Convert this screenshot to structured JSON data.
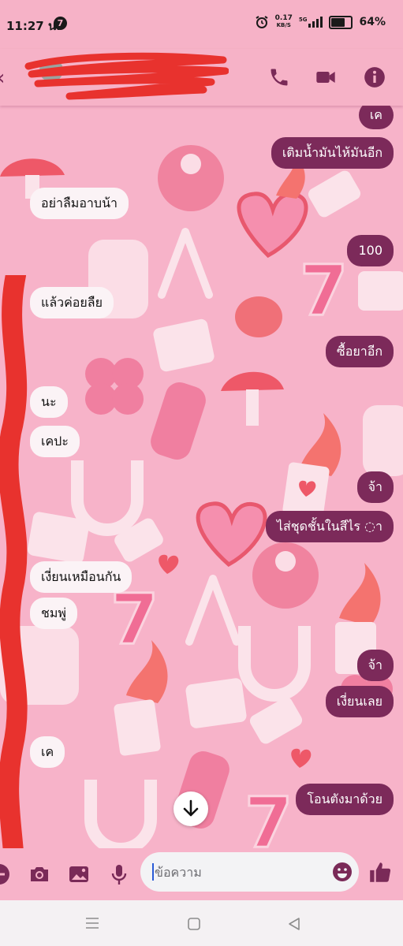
{
  "status_bar": {
    "time": "11:27 น.",
    "notification_count": "7",
    "net_speed_value": "0.17",
    "net_speed_unit": "KB/S",
    "network_type": "5G",
    "battery_level": 0.64,
    "battery_percent": "64%"
  },
  "header": {
    "contact_name_redacted": true,
    "icons": [
      "back-arrow-icon",
      "phone-icon",
      "video-camera-icon",
      "info-icon"
    ]
  },
  "messages": [
    {
      "side": "out",
      "text": "เค"
    },
    {
      "side": "out",
      "text": "เติมน้ำมันไห้มันอีก"
    },
    {
      "side": "in",
      "text": "อย่าลืมอาบน้า"
    },
    {
      "side": "out",
      "text": "100"
    },
    {
      "side": "in",
      "text": "แล้วค่อยลืย"
    },
    {
      "side": "out",
      "text": "ซื้อยาอีก"
    },
    {
      "side": "in",
      "text": "นะ"
    },
    {
      "side": "in",
      "text": "เคปะ"
    },
    {
      "side": "out",
      "text": "จ้า"
    },
    {
      "side": "out",
      "text": "ไส่ชุดชั้นในสีไร ◌า"
    },
    {
      "side": "in",
      "text": "เงี่ยนเหมือนกัน"
    },
    {
      "side": "in",
      "text": "ชมพู่"
    },
    {
      "side": "out",
      "text": "จ้า"
    },
    {
      "side": "out",
      "text": "เงี่ยนเลย"
    },
    {
      "side": "in",
      "text": "เค"
    },
    {
      "side": "out",
      "text": "โอนตังมาด้วย"
    }
  ],
  "composer": {
    "placeholder": "ข้อความ",
    "icons": [
      "minus-icon",
      "camera-icon",
      "gallery-icon",
      "microphone-icon",
      "emoji-icon",
      "thumbs-up-icon"
    ]
  },
  "scroll_button_icon": "arrow-down-icon",
  "navbar_icons": [
    "recent-apps-icon",
    "home-icon",
    "back-icon"
  ],
  "colors": {
    "chat_background": "#f7b3c9",
    "outgoing_bubble": "#7c2a5a",
    "incoming_bubble": "#fbf3f6",
    "accent": "#7a2a58"
  }
}
